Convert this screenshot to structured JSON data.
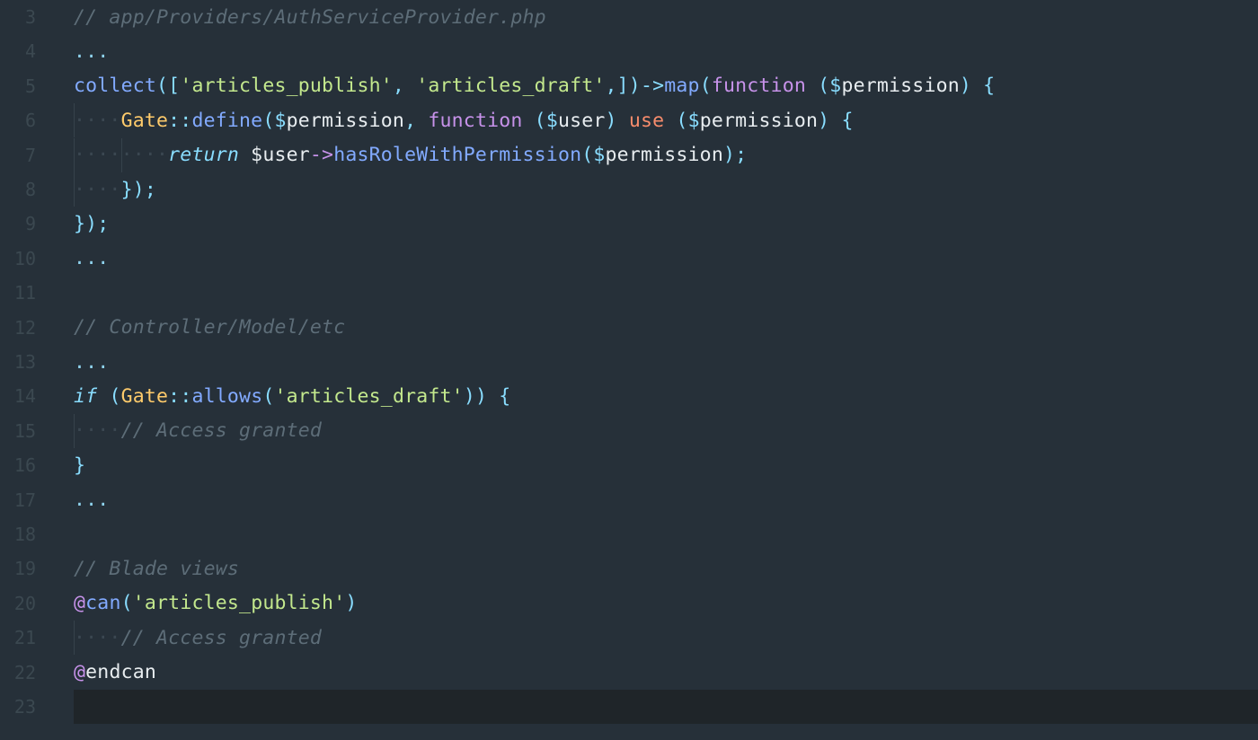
{
  "editor": {
    "lines": [
      {
        "num": "3",
        "tokens": [
          {
            "t": "// app/Providers/AuthServiceProvider.php",
            "c": "comment"
          }
        ]
      },
      {
        "num": "4",
        "tokens": [
          {
            "t": "...",
            "c": "dots"
          }
        ]
      },
      {
        "num": "5",
        "tokens": [
          {
            "t": "collect",
            "c": "func"
          },
          {
            "t": "([",
            "c": "punc"
          },
          {
            "t": "'articles_publish'",
            "c": "str"
          },
          {
            "t": ", ",
            "c": "punc"
          },
          {
            "t": "'articles_draft'",
            "c": "str"
          },
          {
            "t": ",])->",
            "c": "punc"
          },
          {
            "t": "map",
            "c": "func"
          },
          {
            "t": "(",
            "c": "punc"
          },
          {
            "t": "function",
            "c": "kw"
          },
          {
            "t": " ($",
            "c": "punc"
          },
          {
            "t": "permission",
            "c": "var"
          },
          {
            "t": ") {",
            "c": "punc"
          }
        ]
      },
      {
        "num": "6",
        "indent": 1,
        "tokens": [
          {
            "t": "Gate",
            "c": "class"
          },
          {
            "t": "::",
            "c": "punc"
          },
          {
            "t": "define",
            "c": "func"
          },
          {
            "t": "($",
            "c": "punc"
          },
          {
            "t": "permission",
            "c": "var"
          },
          {
            "t": ", ",
            "c": "punc"
          },
          {
            "t": "function",
            "c": "kw"
          },
          {
            "t": " ($",
            "c": "punc"
          },
          {
            "t": "user",
            "c": "var"
          },
          {
            "t": ") ",
            "c": "punc"
          },
          {
            "t": "use",
            "c": "use"
          },
          {
            "t": " ($",
            "c": "punc"
          },
          {
            "t": "permission",
            "c": "var"
          },
          {
            "t": ") {",
            "c": "punc"
          }
        ]
      },
      {
        "num": "7",
        "indent": 2,
        "tokens": [
          {
            "t": "return",
            "c": "italic"
          },
          {
            "t": " $",
            "c": "var"
          },
          {
            "t": "user",
            "c": "var"
          },
          {
            "t": "->",
            "c": "kw"
          },
          {
            "t": "hasRoleWithPermission",
            "c": "func"
          },
          {
            "t": "($",
            "c": "punc"
          },
          {
            "t": "permission",
            "c": "var"
          },
          {
            "t": ");",
            "c": "punc"
          }
        ]
      },
      {
        "num": "8",
        "indent": 1,
        "tokens": [
          {
            "t": "});",
            "c": "punc"
          }
        ]
      },
      {
        "num": "9",
        "tokens": [
          {
            "t": "});",
            "c": "punc"
          }
        ]
      },
      {
        "num": "10",
        "tokens": [
          {
            "t": "...",
            "c": "dots"
          }
        ]
      },
      {
        "num": "11",
        "tokens": []
      },
      {
        "num": "12",
        "tokens": [
          {
            "t": "// Controller/Model/etc",
            "c": "comment"
          }
        ]
      },
      {
        "num": "13",
        "tokens": [
          {
            "t": "...",
            "c": "dots"
          }
        ]
      },
      {
        "num": "14",
        "tokens": [
          {
            "t": "if",
            "c": "italic"
          },
          {
            "t": " (",
            "c": "punc"
          },
          {
            "t": "Gate",
            "c": "class"
          },
          {
            "t": "::",
            "c": "punc"
          },
          {
            "t": "allows",
            "c": "func"
          },
          {
            "t": "(",
            "c": "punc"
          },
          {
            "t": "'articles_draft'",
            "c": "str"
          },
          {
            "t": ")) {",
            "c": "punc"
          }
        ]
      },
      {
        "num": "15",
        "indent": 1,
        "tokens": [
          {
            "t": "// Access granted",
            "c": "comment"
          }
        ]
      },
      {
        "num": "16",
        "tokens": [
          {
            "t": "}",
            "c": "punc"
          }
        ]
      },
      {
        "num": "17",
        "tokens": [
          {
            "t": "...",
            "c": "dots"
          }
        ]
      },
      {
        "num": "18",
        "tokens": []
      },
      {
        "num": "19",
        "tokens": [
          {
            "t": "// Blade views",
            "c": "comment"
          }
        ]
      },
      {
        "num": "20",
        "tokens": [
          {
            "t": "@",
            "c": "at"
          },
          {
            "t": "can",
            "c": "func"
          },
          {
            "t": "(",
            "c": "punc"
          },
          {
            "t": "'articles_publish'",
            "c": "str"
          },
          {
            "t": ")",
            "c": "punc"
          }
        ]
      },
      {
        "num": "21",
        "indent": 1,
        "tokens": [
          {
            "t": "// Access granted",
            "c": "comment"
          }
        ]
      },
      {
        "num": "22",
        "tokens": [
          {
            "t": "@",
            "c": "at"
          },
          {
            "t": "endcan",
            "c": "plain"
          }
        ]
      },
      {
        "num": "23",
        "tokens": [],
        "active": true
      }
    ]
  }
}
